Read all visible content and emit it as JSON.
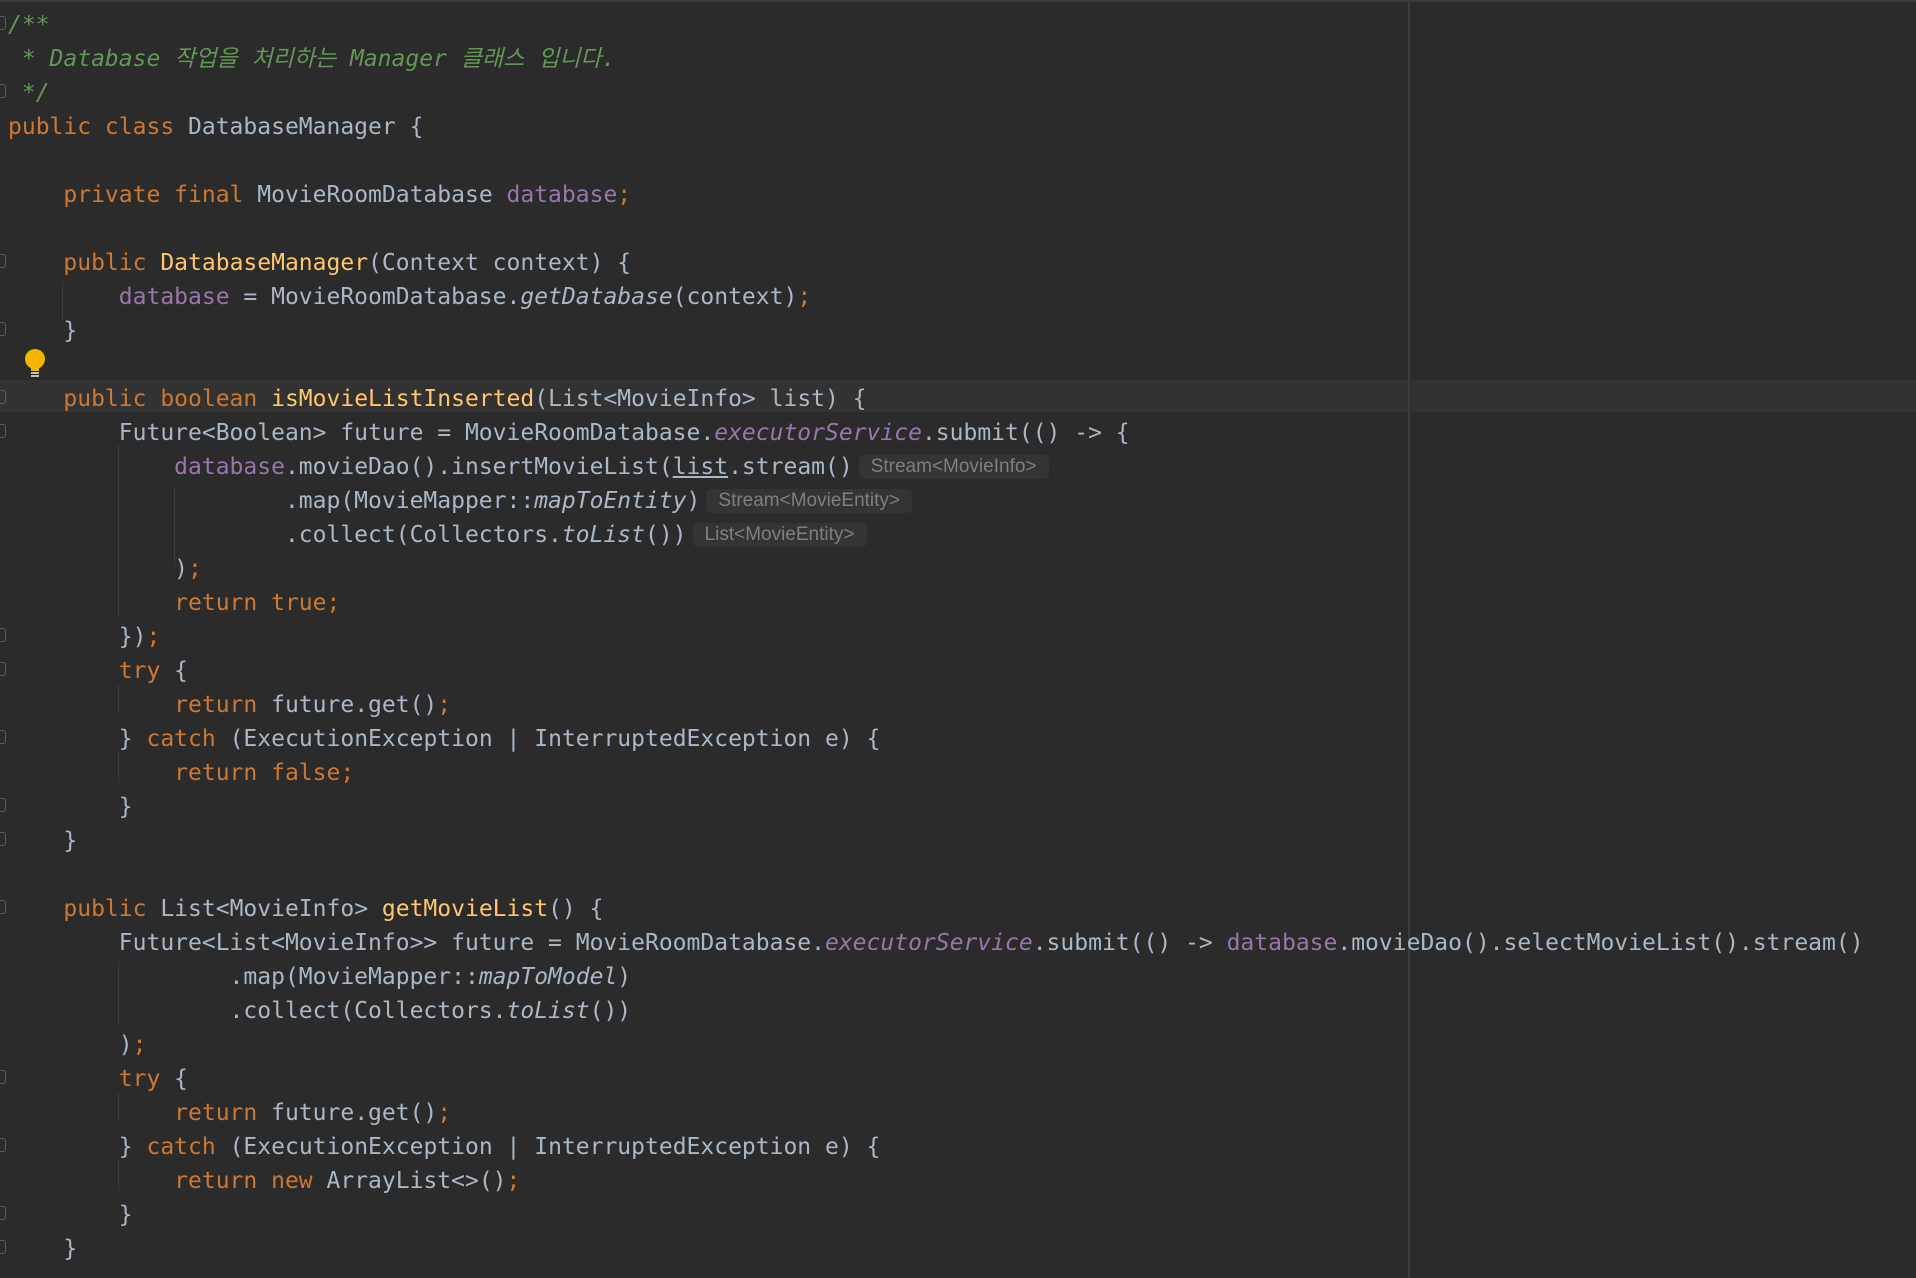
{
  "editor": {
    "lines": [
      {
        "tokens": [
          {
            "t": "/**",
            "c": "cm"
          }
        ]
      },
      {
        "tokens": [
          {
            "t": " * Database 작업을 처리하는 Manager 클래스 입니다.",
            "c": "cm"
          }
        ]
      },
      {
        "tokens": [
          {
            "t": " */",
            "c": "cm"
          }
        ]
      },
      {
        "tokens": [
          {
            "t": "public class ",
            "c": "kw"
          },
          {
            "t": "DatabaseManager {"
          }
        ]
      },
      {
        "tokens": []
      },
      {
        "tokens": [
          {
            "t": "    "
          },
          {
            "t": "private final ",
            "c": "kw"
          },
          {
            "t": "MovieRoomDatabase "
          },
          {
            "t": "database",
            "c": "fd"
          },
          {
            "t": ";",
            "c": "sp"
          }
        ]
      },
      {
        "tokens": []
      },
      {
        "tokens": [
          {
            "t": "    "
          },
          {
            "t": "public ",
            "c": "kw"
          },
          {
            "t": "DatabaseManager",
            "c": "fn"
          },
          {
            "t": "(Context context) {"
          }
        ]
      },
      {
        "tokens": [
          {
            "t": "        "
          },
          {
            "t": "database",
            "c": "fd"
          },
          {
            "t": " = MovieRoomDatabase."
          },
          {
            "t": "getDatabase",
            "c": "it"
          },
          {
            "t": "(context)"
          },
          {
            "t": ";",
            "c": "sp"
          }
        ]
      },
      {
        "tokens": [
          {
            "t": "    }"
          }
        ]
      },
      {
        "tokens": []
      },
      {
        "tokens": [
          {
            "t": "    "
          },
          {
            "t": "public boolean ",
            "c": "kw"
          },
          {
            "t": "isMovieListInserted",
            "c": "fn"
          },
          {
            "t": "(List<MovieInfo> list) {"
          }
        ]
      },
      {
        "tokens": [
          {
            "t": "        Future<Boolean> future = MovieRoomDatabase."
          },
          {
            "t": "executorService",
            "c": "st"
          },
          {
            "t": ".submit(() -> {"
          }
        ]
      },
      {
        "tokens": [
          {
            "t": "            "
          },
          {
            "t": "database",
            "c": "fd"
          },
          {
            "t": ".movieDao().insertMovieList("
          },
          {
            "t": "list",
            "c": "ul"
          },
          {
            "t": ".stream()"
          },
          {
            "t": "Stream<MovieInfo>",
            "c": "hint"
          }
        ]
      },
      {
        "tokens": [
          {
            "t": "                    .map(MovieMapper::"
          },
          {
            "t": "mapToEntity",
            "c": "it"
          },
          {
            "t": ")"
          },
          {
            "t": "Stream<MovieEntity>",
            "c": "hint"
          }
        ]
      },
      {
        "tokens": [
          {
            "t": "                    .collect(Collectors."
          },
          {
            "t": "toList",
            "c": "it"
          },
          {
            "t": "())"
          },
          {
            "t": "List<MovieEntity>",
            "c": "hint"
          }
        ]
      },
      {
        "tokens": [
          {
            "t": "            )"
          },
          {
            "t": ";",
            "c": "sp"
          }
        ]
      },
      {
        "tokens": [
          {
            "t": "            "
          },
          {
            "t": "return true;",
            "c": "kw"
          }
        ]
      },
      {
        "tokens": [
          {
            "t": "        })"
          },
          {
            "t": ";",
            "c": "sp"
          }
        ]
      },
      {
        "tokens": [
          {
            "t": "        "
          },
          {
            "t": "try ",
            "c": "kw"
          },
          {
            "t": "{"
          }
        ]
      },
      {
        "tokens": [
          {
            "t": "            "
          },
          {
            "t": "return ",
            "c": "kw"
          },
          {
            "t": "future.get()"
          },
          {
            "t": ";",
            "c": "sp"
          }
        ]
      },
      {
        "tokens": [
          {
            "t": "        } "
          },
          {
            "t": "catch ",
            "c": "kw"
          },
          {
            "t": "(ExecutionException | InterruptedException e) {"
          }
        ]
      },
      {
        "tokens": [
          {
            "t": "            "
          },
          {
            "t": "return false;",
            "c": "kw"
          }
        ]
      },
      {
        "tokens": [
          {
            "t": "        }"
          }
        ]
      },
      {
        "tokens": [
          {
            "t": "    }"
          }
        ]
      },
      {
        "tokens": []
      },
      {
        "tokens": [
          {
            "t": "    "
          },
          {
            "t": "public ",
            "c": "kw"
          },
          {
            "t": "List<MovieInfo> "
          },
          {
            "t": "getMovieList",
            "c": "fn"
          },
          {
            "t": "() {"
          }
        ]
      },
      {
        "tokens": [
          {
            "t": "        Future<List<MovieInfo>> future = MovieRoomDatabase."
          },
          {
            "t": "executorService",
            "c": "st"
          },
          {
            "t": ".submit(() -> "
          },
          {
            "t": "database",
            "c": "fd"
          },
          {
            "t": ".movieDao().selectMovieList().stream()"
          }
        ]
      },
      {
        "tokens": [
          {
            "t": "                .map(MovieMapper::"
          },
          {
            "t": "mapToModel",
            "c": "it"
          },
          {
            "t": ")"
          }
        ]
      },
      {
        "tokens": [
          {
            "t": "                .collect(Collectors."
          },
          {
            "t": "toList",
            "c": "it"
          },
          {
            "t": "())"
          }
        ]
      },
      {
        "tokens": [
          {
            "t": "        )"
          },
          {
            "t": ";",
            "c": "sp"
          }
        ]
      },
      {
        "tokens": [
          {
            "t": "        "
          },
          {
            "t": "try ",
            "c": "kw"
          },
          {
            "t": "{"
          }
        ]
      },
      {
        "tokens": [
          {
            "t": "            "
          },
          {
            "t": "return ",
            "c": "kw"
          },
          {
            "t": "future.get()"
          },
          {
            "t": ";",
            "c": "sp"
          }
        ]
      },
      {
        "tokens": [
          {
            "t": "        } "
          },
          {
            "t": "catch ",
            "c": "kw"
          },
          {
            "t": "(ExecutionException | InterruptedException e) {"
          }
        ]
      },
      {
        "tokens": [
          {
            "t": "            "
          },
          {
            "t": "return new ",
            "c": "kw"
          },
          {
            "t": "ArrayList<>()"
          },
          {
            "t": ";",
            "c": "sp"
          }
        ]
      },
      {
        "tokens": [
          {
            "t": "        }"
          }
        ]
      },
      {
        "tokens": [
          {
            "t": "    }"
          }
        ]
      }
    ],
    "gutter_icons": [
      {
        "name": "lightbulb-icon",
        "line": 11,
        "color": "#f4b400"
      }
    ],
    "colors": {
      "background": "#2b2b2b",
      "text": "#a9b7c6",
      "keyword": "#cc7832",
      "comment": "#629755",
      "method_declaration": "#ffc66d",
      "field": "#9876aa",
      "inlay_hint": "#7f7f7f"
    }
  }
}
